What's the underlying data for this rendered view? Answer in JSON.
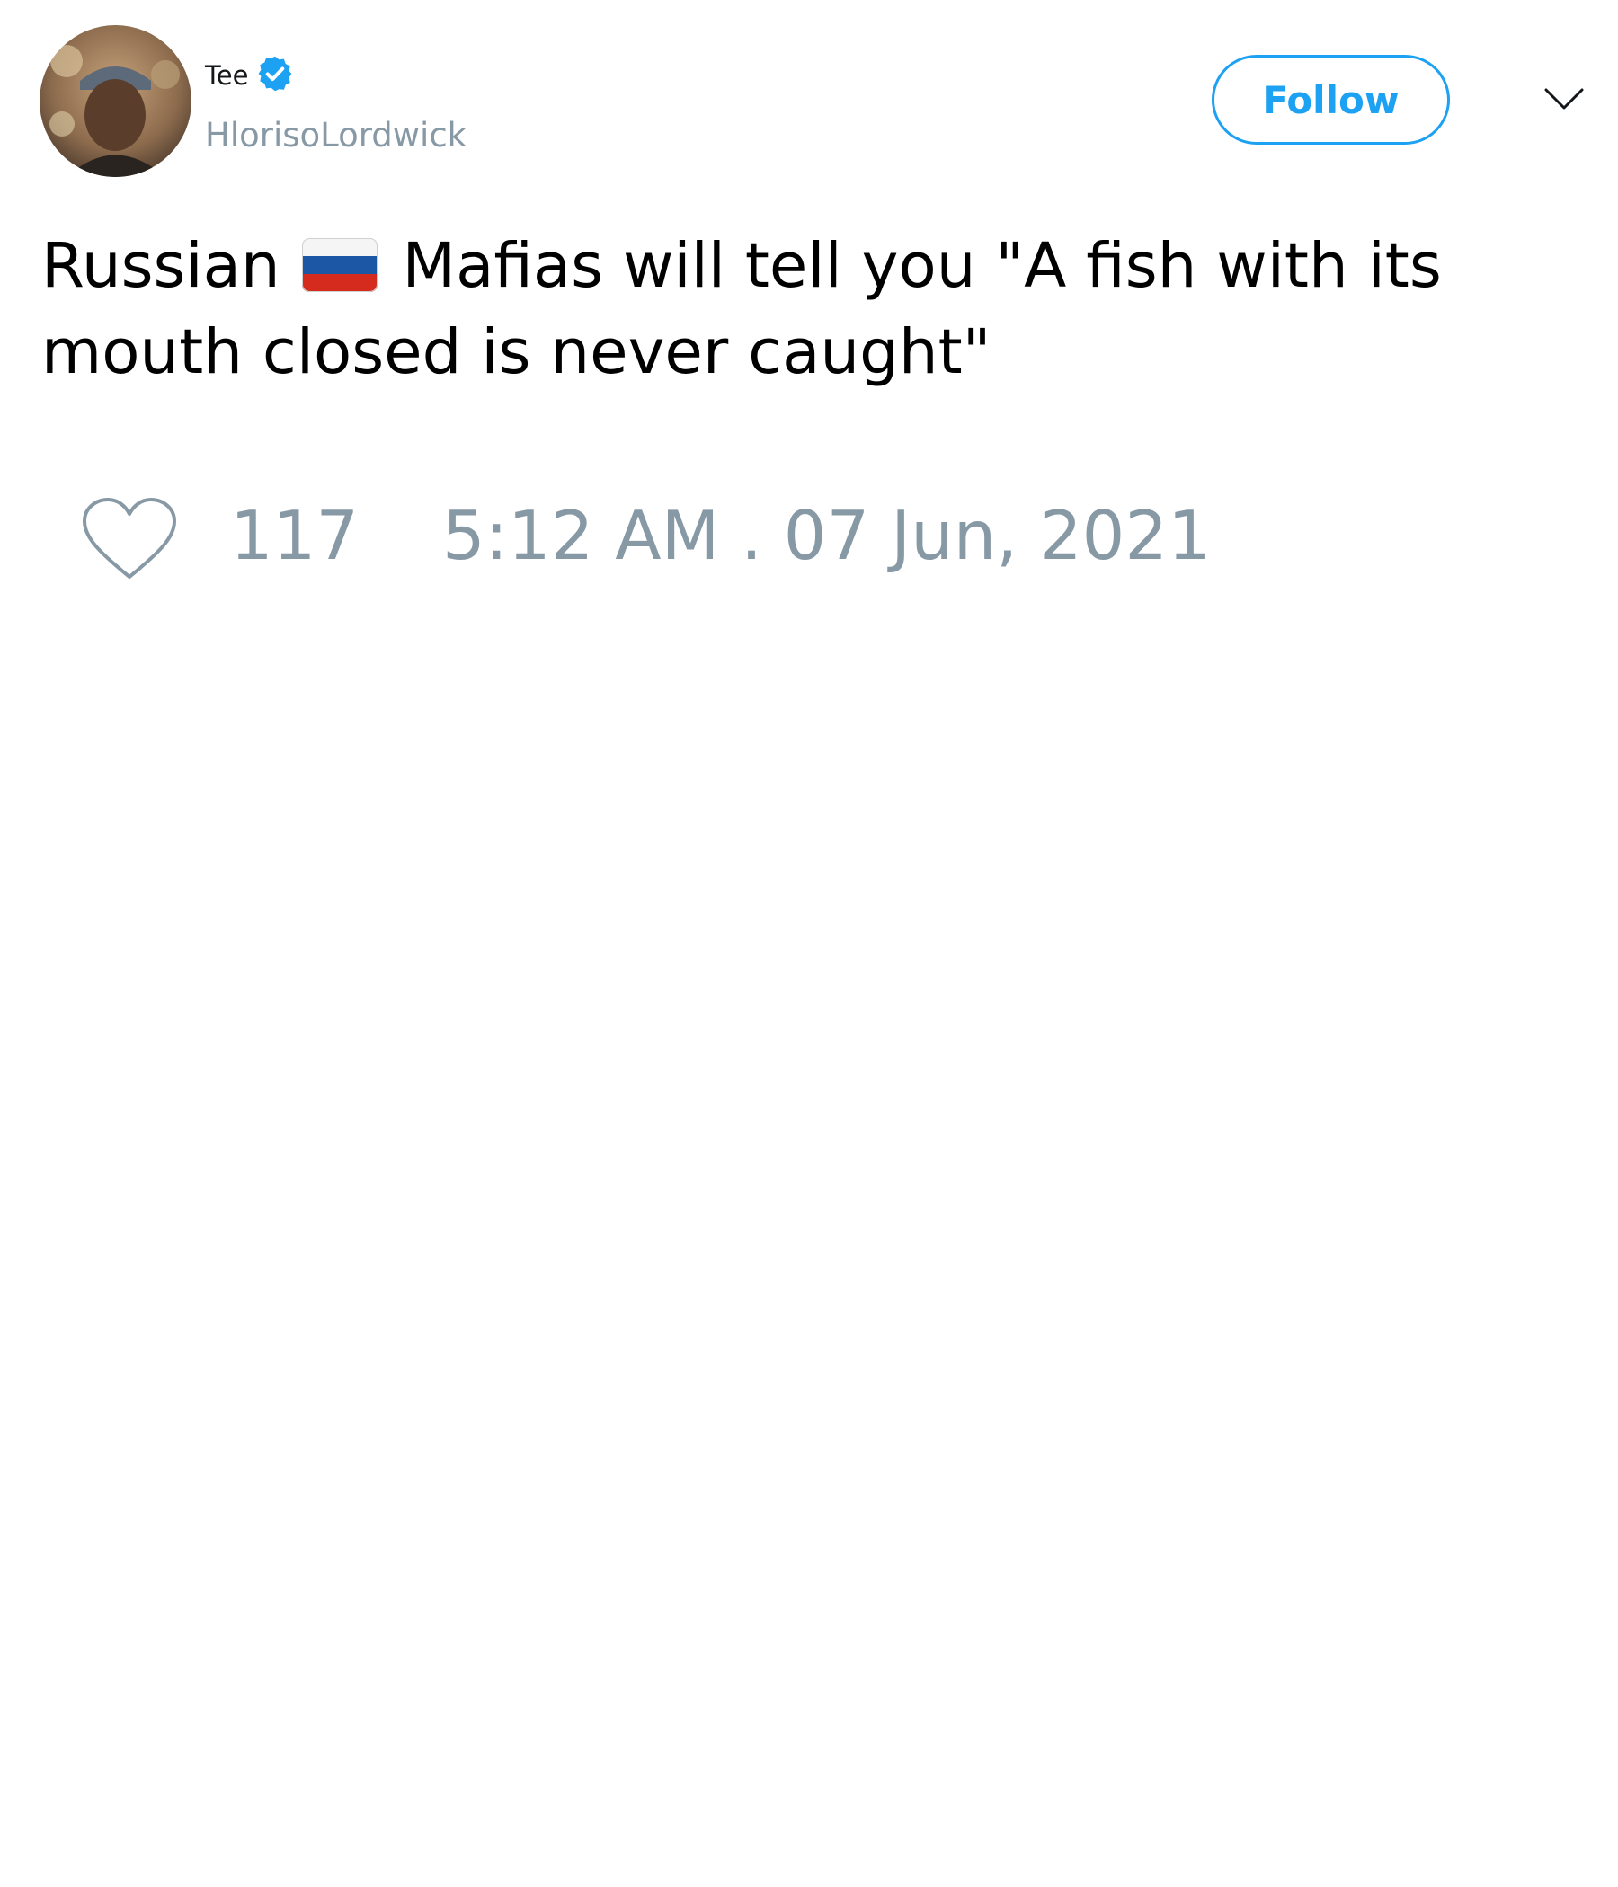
{
  "author": {
    "display_name": "Tee",
    "handle": "HlorisoLordwick",
    "verified": true,
    "avatar_icon": "profile-photo"
  },
  "actions": {
    "follow_label": "Follow",
    "menu_icon": "chevron-down-icon"
  },
  "tweet": {
    "text_before_flag": "Russian",
    "flag": "Russia flag emoji",
    "text_after_flag": "Mafias will tell you \"A fish with its mouth closed is never caught\""
  },
  "footer": {
    "like_icon": "heart-icon",
    "like_count": "117",
    "timestamp": "5:12 AM . 07 Jun, 2021"
  },
  "colors": {
    "accent": "#1da1f2",
    "secondary_text": "#8899a6",
    "primary_text": "#000000"
  }
}
